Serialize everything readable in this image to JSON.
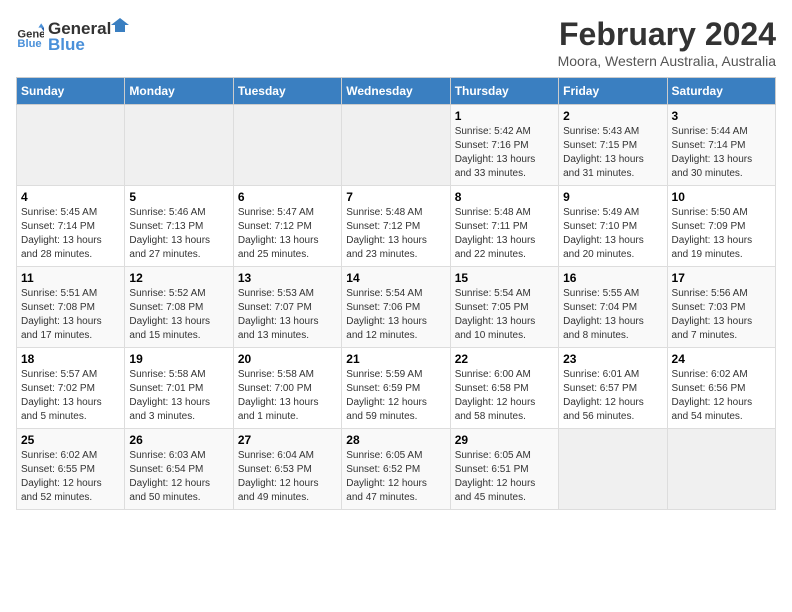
{
  "logo": {
    "text_general": "General",
    "text_blue": "Blue"
  },
  "header": {
    "title": "February 2024",
    "subtitle": "Moora, Western Australia, Australia"
  },
  "calendar": {
    "days_of_week": [
      "Sunday",
      "Monday",
      "Tuesday",
      "Wednesday",
      "Thursday",
      "Friday",
      "Saturday"
    ],
    "weeks": [
      [
        {
          "day": "",
          "info": ""
        },
        {
          "day": "",
          "info": ""
        },
        {
          "day": "",
          "info": ""
        },
        {
          "day": "",
          "info": ""
        },
        {
          "day": "1",
          "info": "Sunrise: 5:42 AM\nSunset: 7:16 PM\nDaylight: 13 hours\nand 33 minutes."
        },
        {
          "day": "2",
          "info": "Sunrise: 5:43 AM\nSunset: 7:15 PM\nDaylight: 13 hours\nand 31 minutes."
        },
        {
          "day": "3",
          "info": "Sunrise: 5:44 AM\nSunset: 7:14 PM\nDaylight: 13 hours\nand 30 minutes."
        }
      ],
      [
        {
          "day": "4",
          "info": "Sunrise: 5:45 AM\nSunset: 7:14 PM\nDaylight: 13 hours\nand 28 minutes."
        },
        {
          "day": "5",
          "info": "Sunrise: 5:46 AM\nSunset: 7:13 PM\nDaylight: 13 hours\nand 27 minutes."
        },
        {
          "day": "6",
          "info": "Sunrise: 5:47 AM\nSunset: 7:12 PM\nDaylight: 13 hours\nand 25 minutes."
        },
        {
          "day": "7",
          "info": "Sunrise: 5:48 AM\nSunset: 7:12 PM\nDaylight: 13 hours\nand 23 minutes."
        },
        {
          "day": "8",
          "info": "Sunrise: 5:48 AM\nSunset: 7:11 PM\nDaylight: 13 hours\nand 22 minutes."
        },
        {
          "day": "9",
          "info": "Sunrise: 5:49 AM\nSunset: 7:10 PM\nDaylight: 13 hours\nand 20 minutes."
        },
        {
          "day": "10",
          "info": "Sunrise: 5:50 AM\nSunset: 7:09 PM\nDaylight: 13 hours\nand 19 minutes."
        }
      ],
      [
        {
          "day": "11",
          "info": "Sunrise: 5:51 AM\nSunset: 7:08 PM\nDaylight: 13 hours\nand 17 minutes."
        },
        {
          "day": "12",
          "info": "Sunrise: 5:52 AM\nSunset: 7:08 PM\nDaylight: 13 hours\nand 15 minutes."
        },
        {
          "day": "13",
          "info": "Sunrise: 5:53 AM\nSunset: 7:07 PM\nDaylight: 13 hours\nand 13 minutes."
        },
        {
          "day": "14",
          "info": "Sunrise: 5:54 AM\nSunset: 7:06 PM\nDaylight: 13 hours\nand 12 minutes."
        },
        {
          "day": "15",
          "info": "Sunrise: 5:54 AM\nSunset: 7:05 PM\nDaylight: 13 hours\nand 10 minutes."
        },
        {
          "day": "16",
          "info": "Sunrise: 5:55 AM\nSunset: 7:04 PM\nDaylight: 13 hours\nand 8 minutes."
        },
        {
          "day": "17",
          "info": "Sunrise: 5:56 AM\nSunset: 7:03 PM\nDaylight: 13 hours\nand 7 minutes."
        }
      ],
      [
        {
          "day": "18",
          "info": "Sunrise: 5:57 AM\nSunset: 7:02 PM\nDaylight: 13 hours\nand 5 minutes."
        },
        {
          "day": "19",
          "info": "Sunrise: 5:58 AM\nSunset: 7:01 PM\nDaylight: 13 hours\nand 3 minutes."
        },
        {
          "day": "20",
          "info": "Sunrise: 5:58 AM\nSunset: 7:00 PM\nDaylight: 13 hours\nand 1 minute."
        },
        {
          "day": "21",
          "info": "Sunrise: 5:59 AM\nSunset: 6:59 PM\nDaylight: 12 hours\nand 59 minutes."
        },
        {
          "day": "22",
          "info": "Sunrise: 6:00 AM\nSunset: 6:58 PM\nDaylight: 12 hours\nand 58 minutes."
        },
        {
          "day": "23",
          "info": "Sunrise: 6:01 AM\nSunset: 6:57 PM\nDaylight: 12 hours\nand 56 minutes."
        },
        {
          "day": "24",
          "info": "Sunrise: 6:02 AM\nSunset: 6:56 PM\nDaylight: 12 hours\nand 54 minutes."
        }
      ],
      [
        {
          "day": "25",
          "info": "Sunrise: 6:02 AM\nSunset: 6:55 PM\nDaylight: 12 hours\nand 52 minutes."
        },
        {
          "day": "26",
          "info": "Sunrise: 6:03 AM\nSunset: 6:54 PM\nDaylight: 12 hours\nand 50 minutes."
        },
        {
          "day": "27",
          "info": "Sunrise: 6:04 AM\nSunset: 6:53 PM\nDaylight: 12 hours\nand 49 minutes."
        },
        {
          "day": "28",
          "info": "Sunrise: 6:05 AM\nSunset: 6:52 PM\nDaylight: 12 hours\nand 47 minutes."
        },
        {
          "day": "29",
          "info": "Sunrise: 6:05 AM\nSunset: 6:51 PM\nDaylight: 12 hours\nand 45 minutes."
        },
        {
          "day": "",
          "info": ""
        },
        {
          "day": "",
          "info": ""
        }
      ]
    ]
  }
}
